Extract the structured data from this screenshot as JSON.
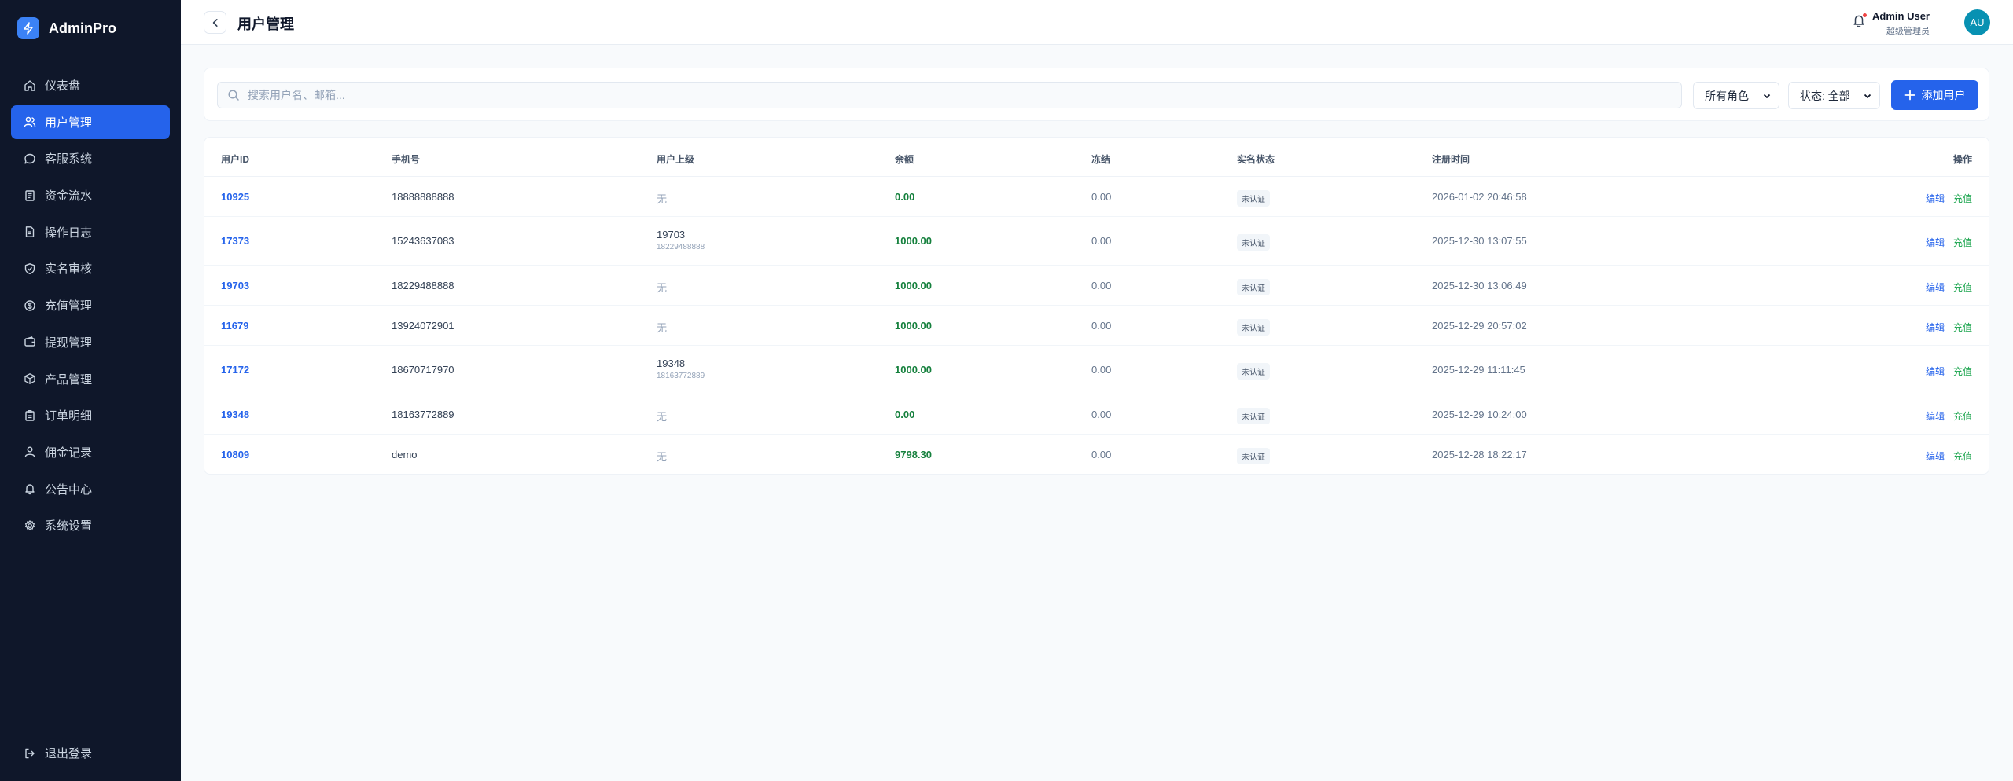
{
  "brand": {
    "name": "AdminPro"
  },
  "sidebar": {
    "items": [
      {
        "label": "仪表盘",
        "icon": "home-icon"
      },
      {
        "label": "用户管理",
        "icon": "users-icon",
        "active": true
      },
      {
        "label": "客服系统",
        "icon": "chat-icon"
      },
      {
        "label": "资金流水",
        "icon": "ledger-icon"
      },
      {
        "label": "操作日志",
        "icon": "file-icon"
      },
      {
        "label": "实名审核",
        "icon": "shield-icon"
      },
      {
        "label": "充值管理",
        "icon": "coin-icon"
      },
      {
        "label": "提现管理",
        "icon": "wallet-icon"
      },
      {
        "label": "产品管理",
        "icon": "box-icon"
      },
      {
        "label": "订单明细",
        "icon": "clipboard-icon"
      },
      {
        "label": "佣金记录",
        "icon": "user-icon"
      },
      {
        "label": "公告中心",
        "icon": "bell-icon"
      },
      {
        "label": "系统设置",
        "icon": "gear-icon"
      }
    ],
    "logout_label": "退出登录"
  },
  "header": {
    "title": "用户管理",
    "user_name": "Admin User",
    "user_role": "超级管理员",
    "avatar_initials": "AU"
  },
  "filters": {
    "search_placeholder": "搜索用户名、邮箱...",
    "role_select": "所有角色",
    "status_select": "状态: 全部",
    "add_button": "添加用户"
  },
  "table": {
    "columns": [
      "用户ID",
      "手机号",
      "用户上级",
      "余额",
      "冻结",
      "实名状态",
      "注册时间",
      "操作"
    ],
    "edit_label": "编辑",
    "recharge_label": "充值",
    "rows": [
      {
        "id": "10925",
        "phone": "18888888888",
        "superior_id": "",
        "superior_phone": "",
        "superior_none": "无",
        "balance": "0.00",
        "frozen": "0.00",
        "verify": "未认证",
        "registered": "2026-01-02 20:46:58"
      },
      {
        "id": "17373",
        "phone": "15243637083",
        "superior_id": "19703",
        "superior_phone": "18229488888",
        "superior_none": "",
        "balance": "1000.00",
        "frozen": "0.00",
        "verify": "未认证",
        "registered": "2025-12-30 13:07:55"
      },
      {
        "id": "19703",
        "phone": "18229488888",
        "superior_id": "",
        "superior_phone": "",
        "superior_none": "无",
        "balance": "1000.00",
        "frozen": "0.00",
        "verify": "未认证",
        "registered": "2025-12-30 13:06:49"
      },
      {
        "id": "11679",
        "phone": "13924072901",
        "superior_id": "",
        "superior_phone": "",
        "superior_none": "无",
        "balance": "1000.00",
        "frozen": "0.00",
        "verify": "未认证",
        "registered": "2025-12-29 20:57:02"
      },
      {
        "id": "17172",
        "phone": "18670717970",
        "superior_id": "19348",
        "superior_phone": "18163772889",
        "superior_none": "",
        "balance": "1000.00",
        "frozen": "0.00",
        "verify": "未认证",
        "registered": "2025-12-29 11:11:45"
      },
      {
        "id": "19348",
        "phone": "18163772889",
        "superior_id": "",
        "superior_phone": "",
        "superior_none": "无",
        "balance": "0.00",
        "frozen": "0.00",
        "verify": "未认证",
        "registered": "2025-12-29 10:24:00"
      },
      {
        "id": "10809",
        "phone": "demo",
        "superior_id": "",
        "superior_phone": "",
        "superior_none": "无",
        "balance": "9798.30",
        "frozen": "0.00",
        "verify": "未认证",
        "registered": "2025-12-28 18:22:17"
      }
    ]
  },
  "colors": {
    "sidebar_bg": "#0f172a",
    "accent": "#2563eb",
    "balance_green": "#15803d",
    "avatar_bg": "#0891b2"
  }
}
